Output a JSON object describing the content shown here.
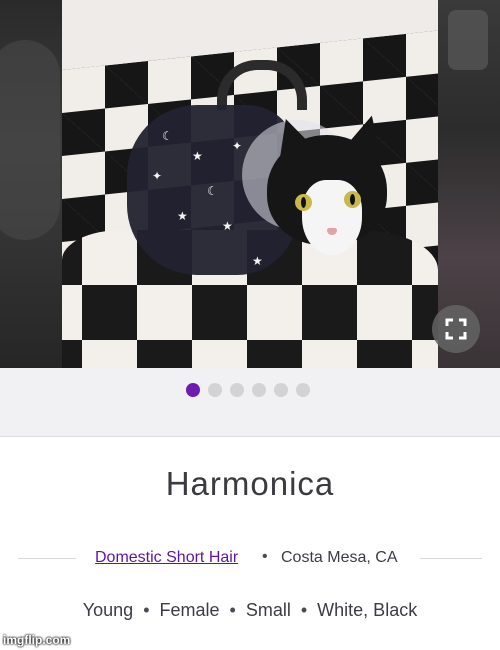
{
  "pet": {
    "name": "Harmonica",
    "breed": "Domestic Short Hair",
    "location": "Costa Mesa, CA",
    "age": "Young",
    "gender": "Female",
    "size": "Small",
    "colors": "White, Black"
  },
  "gallery": {
    "photo_count": 6,
    "active_index": 0,
    "expand_icon": "expand-icon"
  },
  "separators": {
    "bullet": "•"
  },
  "theme": {
    "accent": "#6d1bb0",
    "link": "#5b16a8",
    "text": "#3a3a40",
    "dot_inactive": "#d3d3d6"
  },
  "watermark": "imgflip.com"
}
